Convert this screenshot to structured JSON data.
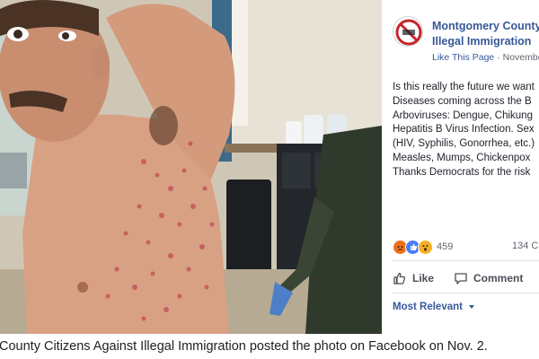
{
  "post": {
    "page_name_line1": "Montgomery County",
    "page_name_line2": "Illegal Immigration",
    "like_page": "Like This Page",
    "separator": "·",
    "date": "November",
    "text_lines": [
      "Is this really the future we want",
      "Diseases coming across the B",
      "Arboviruses: Dengue, Chikung",
      "Hepatitis B Virus Infection. Sex",
      "(HIV, Syphilis, Gonorrhea, etc.)",
      "Measles, Mumps, Chickenpox",
      "Thanks Democrats for the risk"
    ],
    "reaction_count": "459",
    "comment_count": "134 C",
    "like_label": "Like",
    "comment_label": "Comment",
    "sort_label": "Most Relevant"
  },
  "caption": "County Citizens Against Illegal Immigration posted the photo on Facebook on Nov. 2.",
  "colors": {
    "link_blue": "#365899",
    "body_text": "#1d2129",
    "meta_gray": "#616770",
    "angry": "#f0701a",
    "like": "#4a7cf2",
    "wow": "#f7b125"
  },
  "icons": {
    "avatar": "no-illegal-immigration-logo-icon",
    "like": "thumbs-up-icon",
    "comment": "speech-bubble-icon",
    "sort": "caret-down-icon"
  }
}
